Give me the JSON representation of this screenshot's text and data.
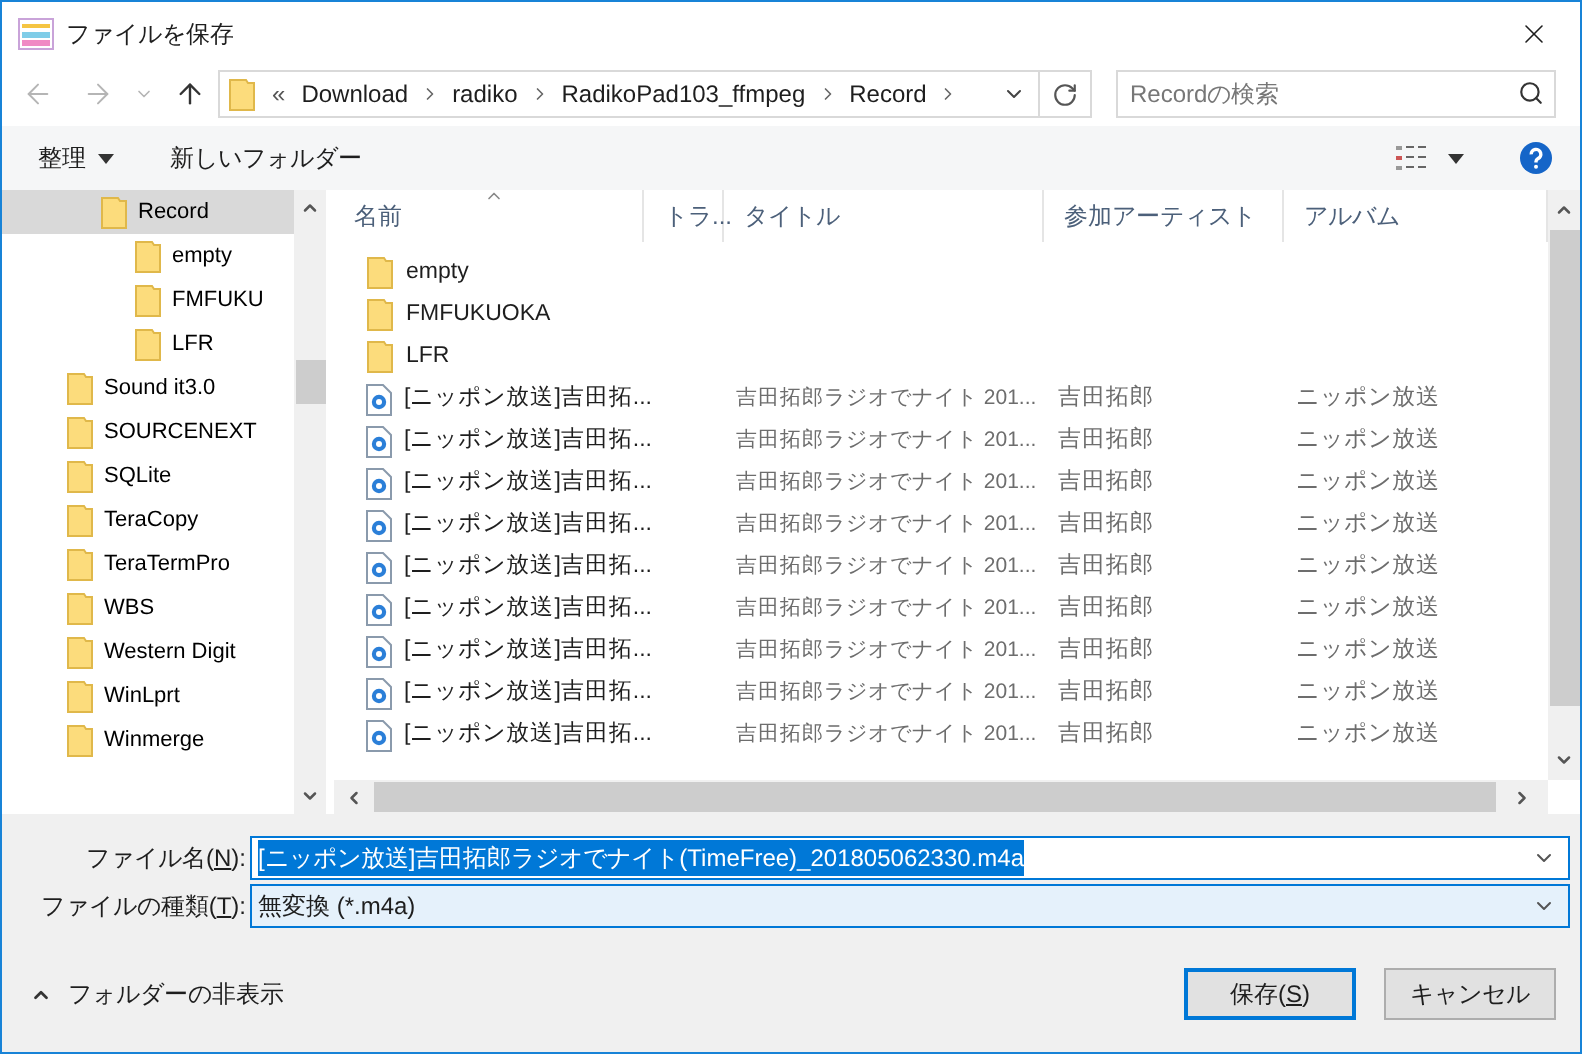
{
  "window": {
    "title": "ファイルを保存"
  },
  "address_bar": {
    "overflow": "«",
    "crumbs": [
      "Download",
      "radiko",
      "RadikoPad103_ffmpeg",
      "Record"
    ]
  },
  "search": {
    "placeholder": "Recordの検索"
  },
  "toolbar": {
    "organize": "整理",
    "new_folder": "新しいフォルダー"
  },
  "nav_tree": {
    "items": [
      {
        "children": [
          {
            "label": "Record",
            "selected": true,
            "children": [
              {
                "label": "empty",
                "selected": false
              },
              {
                "label": "FMFUKU",
                "selected": false
              },
              {
                "label": "LFR",
                "selected": false
              }
            ]
          }
        ]
      },
      {
        "label": "Sound it3.0",
        "selected": false
      },
      {
        "label": "SOURCENEXT",
        "selected": false
      },
      {
        "label": "SQLite",
        "selected": false
      },
      {
        "label": "TeraCopy",
        "selected": false
      },
      {
        "label": "TeraTermPro",
        "selected": false
      },
      {
        "label": "WBS",
        "selected": false
      },
      {
        "label": "Western Digit",
        "selected": false
      },
      {
        "label": "WinLprt",
        "selected": false
      },
      {
        "label": "Winmerge",
        "selected": false
      }
    ]
  },
  "file_list": {
    "columns": [
      {
        "label": "名前",
        "sorted": true
      },
      {
        "label": "トラ...",
        "sorted": false
      },
      {
        "label": "タイトル",
        "sorted": false
      },
      {
        "label": "参加アーティスト",
        "sorted": false
      },
      {
        "label": "アルバム",
        "sorted": false
      }
    ],
    "rows": [
      {
        "kind": "folder",
        "name": "empty"
      },
      {
        "kind": "folder",
        "name": "FMFUKUOKA"
      },
      {
        "kind": "folder",
        "name": "LFR"
      },
      {
        "kind": "audio",
        "name": "[ニッポン放送]吉田拓...",
        "title": "吉田拓郎ラジオでナイト 201...",
        "artist": "吉田拓郎",
        "album": "ニッポン放送"
      },
      {
        "kind": "audio",
        "name": "[ニッポン放送]吉田拓...",
        "title": "吉田拓郎ラジオでナイト 201...",
        "artist": "吉田拓郎",
        "album": "ニッポン放送"
      },
      {
        "kind": "audio",
        "name": "[ニッポン放送]吉田拓...",
        "title": "吉田拓郎ラジオでナイト 201...",
        "artist": "吉田拓郎",
        "album": "ニッポン放送"
      },
      {
        "kind": "audio",
        "name": "[ニッポン放送]吉田拓...",
        "title": "吉田拓郎ラジオでナイト 201...",
        "artist": "吉田拓郎",
        "album": "ニッポン放送"
      },
      {
        "kind": "audio",
        "name": "[ニッポン放送]吉田拓...",
        "title": "吉田拓郎ラジオでナイト 201...",
        "artist": "吉田拓郎",
        "album": "ニッポン放送"
      },
      {
        "kind": "audio",
        "name": "[ニッポン放送]吉田拓...",
        "title": "吉田拓郎ラジオでナイト 201...",
        "artist": "吉田拓郎",
        "album": "ニッポン放送"
      },
      {
        "kind": "audio",
        "name": "[ニッポン放送]吉田拓...",
        "title": "吉田拓郎ラジオでナイト 201...",
        "artist": "吉田拓郎",
        "album": "ニッポン放送"
      },
      {
        "kind": "audio",
        "name": "[ニッポン放送]吉田拓...",
        "title": "吉田拓郎ラジオでナイト 201...",
        "artist": "吉田拓郎",
        "album": "ニッポン放送"
      },
      {
        "kind": "audio",
        "name": "[ニッポン放送]吉田拓...",
        "title": "吉田拓郎ラジオでナイト 201...",
        "artist": "吉田拓郎",
        "album": "ニッポン放送"
      }
    ]
  },
  "file_name": {
    "label_before": "ファイル名(",
    "access_key": "N",
    "label_after": "):",
    "value": "[ニッポン放送]吉田拓郎ラジオでナイト(TimeFree)_201805062330.m4a",
    "selected": true
  },
  "file_type": {
    "label_before": "ファイルの種類(",
    "access_key": "T",
    "label_after": "):",
    "value": "無変換 (*.m4a)"
  },
  "hide_folders": "フォルダーの非表示",
  "buttons": [
    {
      "label_before": "保存(",
      "access_key": "S",
      "label_after": ")",
      "default": true
    },
    {
      "label_before": "キャンセル",
      "default": false
    }
  ]
}
